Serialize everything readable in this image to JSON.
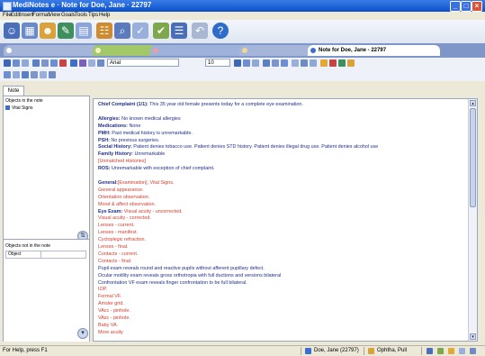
{
  "window": {
    "title": "MediNotes e · Note for Doe, Jane · 22797"
  },
  "menu": [
    "File",
    "Edit",
    "Insert",
    "Format",
    "View",
    "Goals",
    "Tools",
    "Tips",
    "Help"
  ],
  "tabs": {
    "active_label": "Note for Doe, Jane - 22797"
  },
  "format_toolbar": {
    "font": "Arial",
    "size": "10"
  },
  "left_panel": {
    "note_tab": "Note",
    "objects_in_note_label": "Objects in the note",
    "objects_in_note": [
      "Vital Signs"
    ],
    "objects_not_in_note_label": "Objects not in the note",
    "object_column": "Object"
  },
  "note": {
    "lines": [
      {
        "l": "Chief Complaint (1/1):",
        "t": " This 35 year old female presents today for a complete eye examination."
      },
      {
        "l": "",
        "t": ""
      },
      {
        "l": "Allergies:",
        "t": " No known medical allergies"
      },
      {
        "l": "Medications:",
        "t": " None"
      },
      {
        "l": "PMH:",
        "t": " Past medical history is unremarkable."
      },
      {
        "l": "PSH:",
        "t": " No previous surgeries."
      },
      {
        "l": "Social History:",
        "t": " Patient denies tobacco use. Patient denies STD history. Patient denies illegal drug use. Patient denies alcohol use"
      },
      {
        "l": "Family History:",
        "t": " Unremarkable"
      },
      {
        "l": "",
        "t": "[Unmatched Histories]"
      },
      {
        "l": "ROS:",
        "t": " Unremarkable with exception of chief complaint."
      },
      {
        "l": "",
        "t": ""
      },
      {
        "l": "General:",
        "t": "[Examination], Vital Signs."
      },
      {
        "l": "",
        "t": "   General appearance."
      },
      {
        "l": "",
        "t": "   Orientation observation."
      },
      {
        "l": "",
        "t": "   Mood & affect observation."
      },
      {
        "l": "Eye Exam:",
        "t": " Visual acuity - uncorrected."
      },
      {
        "l": "",
        "t": "   Visual acuity - corrected."
      },
      {
        "l": "",
        "t": "   Lenses - current."
      },
      {
        "l": "",
        "t": "   Lenses - manifest."
      },
      {
        "l": "",
        "t": "   Cycloplegic refraction."
      },
      {
        "l": "",
        "t": "   Lenses - final."
      },
      {
        "l": "",
        "t": "   Contacts - current."
      },
      {
        "l": "",
        "t": "   Contacts - final."
      },
      {
        "l": "",
        "t": "   Pupil exam reveals round and reactive pupils without afferent pupillary defect."
      },
      {
        "l": "",
        "t": "   Ocular motility exam reveals gross orthotropia with full ductions and versions bilateral"
      },
      {
        "l": "",
        "t": "   Confrontation VF exam reveals finger confrontation to be full bilateral."
      },
      {
        "l": "",
        "t": "   IOP."
      },
      {
        "l": "",
        "t": "   Formal VF."
      },
      {
        "l": "",
        "t": "   Amsler grid."
      },
      {
        "l": "",
        "t": "   VAcc - pinhole."
      },
      {
        "l": "",
        "t": "   VAsc - pinhole."
      },
      {
        "l": "",
        "t": "   Baby VA."
      },
      {
        "l": "",
        "t": "   More acuity"
      }
    ]
  },
  "status": {
    "help": "For Help, press F1",
    "patient": "Doe, Jane (22797)",
    "provider": "Ophtha, Pull"
  }
}
